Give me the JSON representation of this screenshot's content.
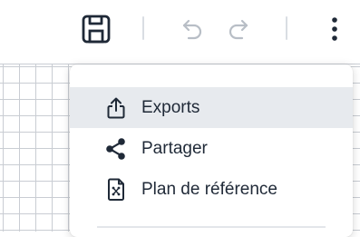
{
  "toolbar": {
    "icons": [
      "save-icon",
      "undo-icon",
      "redo-icon",
      "more-vertical-icon"
    ],
    "colors": {
      "active_icon": "#1f2937",
      "disabled_icon": "#b8bec6",
      "separator": "#d9dde3"
    }
  },
  "menu": {
    "items": [
      {
        "label": "Exports",
        "icon": "share-upload-icon",
        "active": true
      },
      {
        "label": "Partager",
        "icon": "share-nodes-icon",
        "active": false
      },
      {
        "label": "Plan de référence",
        "icon": "reference-plan-icon",
        "active": false
      }
    ],
    "colors": {
      "hover_bg": "#e7eaee",
      "text": "#1f2937"
    }
  },
  "canvas": {
    "grid_color": "#c9cdd3"
  }
}
